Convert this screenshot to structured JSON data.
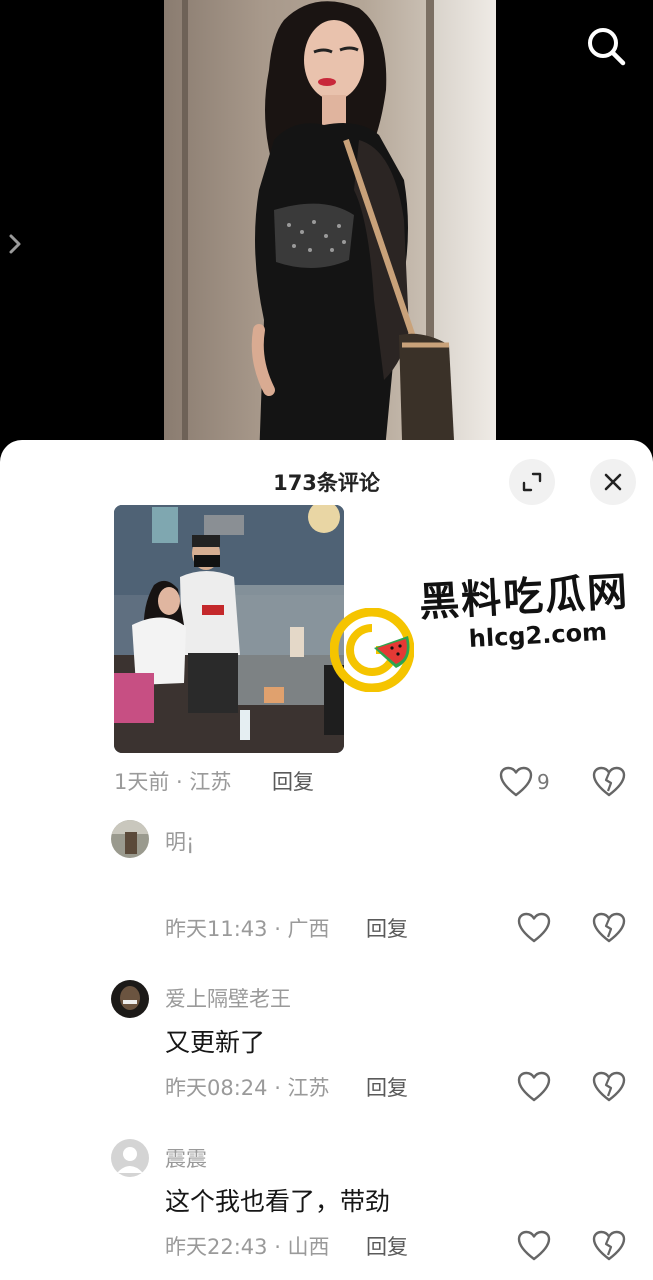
{
  "comments_panel": {
    "title": "173条评论"
  },
  "first_comment": {
    "time_location": "1天前 · 江苏",
    "reply_label": "回复",
    "like_count": "9"
  },
  "comments": [
    {
      "username": "明¡",
      "content_emoji": "husky-emoji",
      "time_location": "昨天11:43 · 广西",
      "reply_label": "回复"
    },
    {
      "username": "爱上隔壁老王",
      "content": "又更新了",
      "time_location": "昨天08:24 · 江苏",
      "reply_label": "回复"
    },
    {
      "username": "震震",
      "content": "这个我也看了，带劲",
      "time_location": "昨天22:43 · 山西",
      "reply_label": "回复"
    }
  ],
  "watermark": {
    "title": "黑料吃瓜网",
    "url": "hlcg2.com"
  },
  "colors": {
    "accent_watermark": "#f5c400",
    "text_primary": "#161616",
    "text_secondary": "#9a9a9a"
  }
}
